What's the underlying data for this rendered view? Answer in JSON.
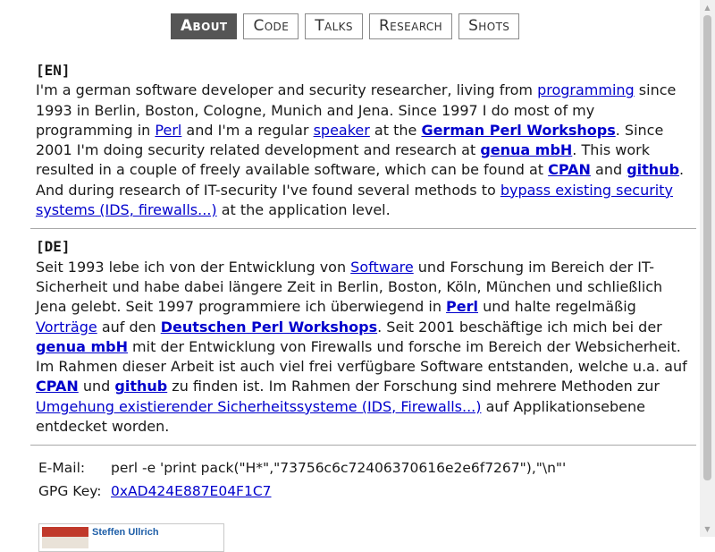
{
  "nav": [
    {
      "label": "About",
      "active": true
    },
    {
      "label": "Code",
      "active": false
    },
    {
      "label": "Talks",
      "active": false
    },
    {
      "label": "Research",
      "active": false
    },
    {
      "label": "Shots",
      "active": false
    }
  ],
  "en": {
    "tag": "[EN]",
    "t1": "I'm a german software developer and security researcher, living from ",
    "l_programming": "programming",
    "t2": " since 1993 in Berlin, Boston, Cologne, Munich and Jena. Since 1997 I do most of my programming in ",
    "l_perl": "Perl",
    "t3": " and I'm a regular ",
    "l_speaker": "speaker",
    "t4": " at the ",
    "l_gpw": "German Perl Workshops",
    "t5": ". Since 2001 I'm doing security related development and research at ",
    "l_genua": "genua mbH",
    "t6": ". This work resulted in a couple of freely available software, which can be found at ",
    "l_cpan": "CPAN",
    "t7": " and ",
    "l_github": "github",
    "t8": ". And during research of IT-security I've found several methods to ",
    "l_bypass": "bypass existing security systems (IDS, firewalls...)",
    "t9": " at the application level."
  },
  "de": {
    "tag": "[DE]",
    "t1": "Seit 1993 lebe ich von der Entwicklung von ",
    "l_software": "Software",
    "t2": " und Forschung im Bereich der IT-Sicherheit und habe dabei längere Zeit in Berlin, Boston, Köln, München und schließlich Jena gelebt. Seit 1997 programmiere ich überwiegend in ",
    "l_perl": "Perl",
    "t3": " und halte regelmäßig ",
    "l_vortraege": "Vorträge",
    "t4": " auf den ",
    "l_dpw": "Deutschen Perl Workshops",
    "t5": ". Seit 2001 beschäftige ich mich bei der ",
    "l_genua": "genua mbH",
    "t6": " mit der Entwicklung von Firewalls und forsche im Bereich der Websicherheit. Im Rahmen dieser Arbeit ist auch viel frei verfügbare Software entstanden, welche u.a. auf ",
    "l_cpan": "CPAN",
    "t7": " und ",
    "l_github": "github",
    "t8": " zu finden ist. Im Rahmen der Forschung sind mehrere Methoden zur ",
    "l_umgehung": "Umgehung existierender Sicherheitssysteme (IDS, Firewalls...)",
    "t9": " auf Applikationsebene entdecket worden."
  },
  "contact": {
    "email_label": "E-Mail:",
    "email_value": "perl -e 'print pack(\"H*\",\"73756c6c72406370616e2e6f7267\"),\"\\n\"'",
    "gpg_label": "GPG Key:",
    "gpg_value": "0xAD424E887E04F1C7"
  },
  "badge": {
    "name": "Steffen Ullrich"
  },
  "icons": {
    "scroll_up": "scroll-up-arrow-icon",
    "scroll_down": "scroll-down-arrow-icon"
  }
}
